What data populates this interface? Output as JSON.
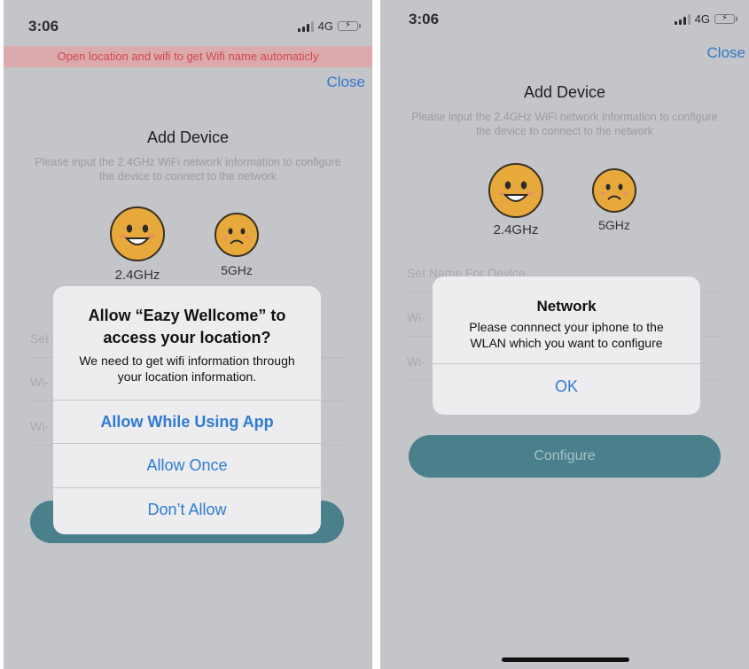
{
  "left": {
    "status": {
      "time": "3:06",
      "network": "4G"
    },
    "banner": "Open location and wifi to get Wifi name automaticly",
    "close_label": "Close",
    "title": "Add Device",
    "description": "Please input the 2.4GHz WiFi network information to configure the device to connect to the network",
    "band_24": "2.4GHz",
    "band_5": "5GHz",
    "fields": [
      "Set",
      "Wi-",
      "Wi-"
    ],
    "alert": {
      "title": "Allow “Eazy Wellcome” to access your location?",
      "message": "We need to get wifi information through your location information.",
      "buttons": [
        "Allow While Using App",
        "Allow Once",
        "Don’t Allow"
      ]
    }
  },
  "right": {
    "status": {
      "time": "3:06",
      "network": "4G"
    },
    "close_label": "Close",
    "title": "Add Device",
    "description": "Please input the 2.4GHz WiFi network information to configure the device to connect to the network",
    "band_24": "2.4GHz",
    "band_5": "5GHz",
    "fields": [
      "Set Name For Device",
      "Wi-",
      "Wi-"
    ],
    "configure_label": "Configure",
    "alert": {
      "title": "Network",
      "message": "Please connnect your iphone to the WLAN which you want to configure",
      "ok_label": "OK"
    }
  },
  "colors": {
    "accent": "#3478c8",
    "configure_button": "#4a7f8c",
    "face": "#e8a93c",
    "banner_text": "#d3474b"
  },
  "icons": [
    "signal-icon",
    "battery-icon",
    "happy-face-icon",
    "sad-face-icon"
  ]
}
